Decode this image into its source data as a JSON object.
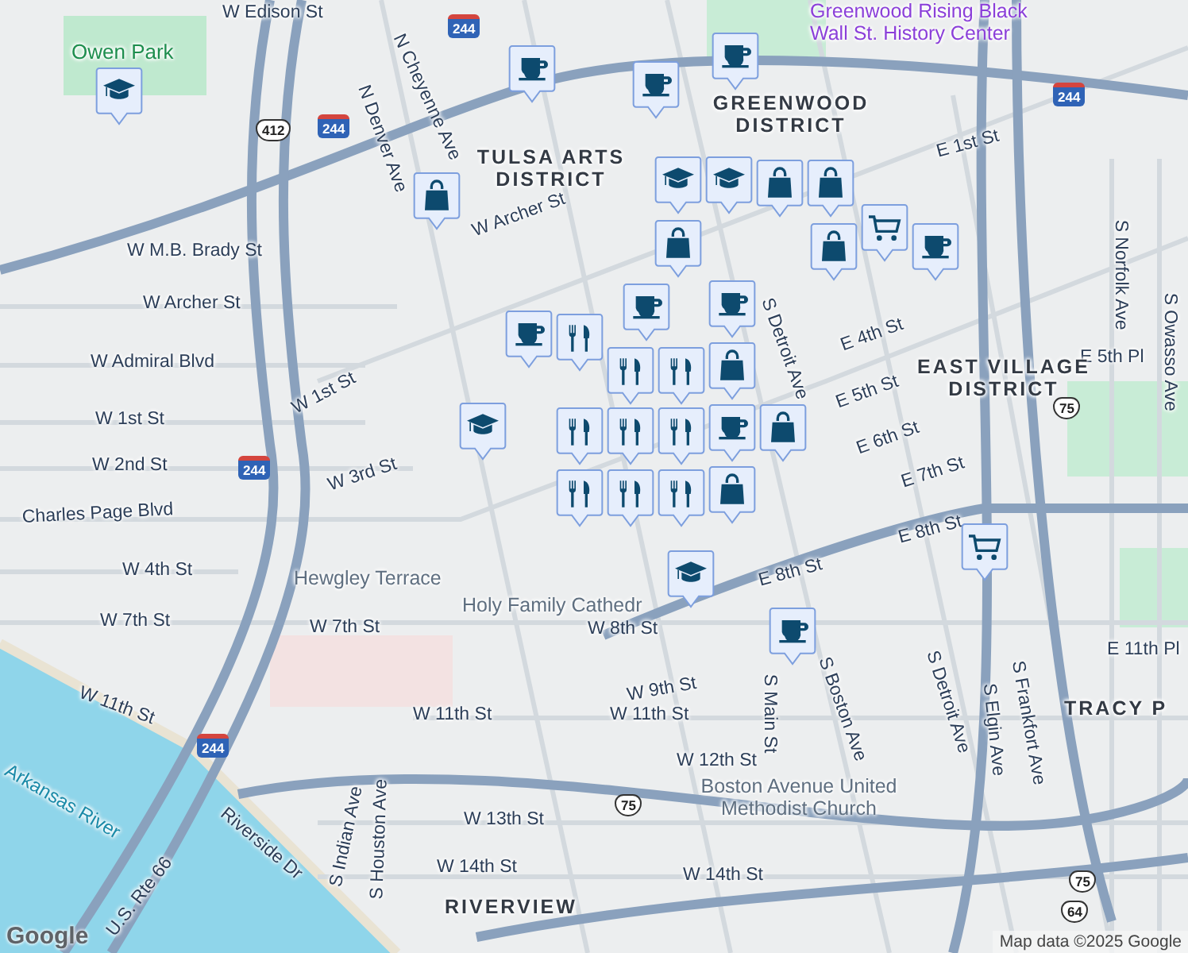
{
  "map": {
    "labels": [
      {
        "kind": "street",
        "text": "W Edison St"
      },
      {
        "kind": "street",
        "text": "N Cheyenne Ave"
      },
      {
        "kind": "street",
        "text": "N Denver Ave"
      },
      {
        "kind": "street",
        "text": "W Archer St"
      },
      {
        "kind": "street",
        "text": "W M.B. Brady St"
      },
      {
        "kind": "street",
        "text": "W Archer St"
      },
      {
        "kind": "street",
        "text": "W Admiral Blvd"
      },
      {
        "kind": "street",
        "text": "W 1st St"
      },
      {
        "kind": "street",
        "text": "W 2nd St"
      },
      {
        "kind": "street",
        "text": "W 1st St"
      },
      {
        "kind": "street",
        "text": "Charles Page Blvd"
      },
      {
        "kind": "street",
        "text": "W 3rd St"
      },
      {
        "kind": "street",
        "text": "W 4th St"
      },
      {
        "kind": "street",
        "text": "W 7th St"
      },
      {
        "kind": "street",
        "text": "W 7th St"
      },
      {
        "kind": "street",
        "text": "W 11th St"
      },
      {
        "kind": "street",
        "text": "W 11th St"
      },
      {
        "kind": "street",
        "text": "Riverside Dr"
      },
      {
        "kind": "street",
        "text": "S Indian Ave"
      },
      {
        "kind": "street",
        "text": "S Houston Ave"
      },
      {
        "kind": "street",
        "text": "W 13th St"
      },
      {
        "kind": "street",
        "text": "W 14th St"
      },
      {
        "kind": "street",
        "text": "U.S. Rte 66"
      },
      {
        "kind": "street",
        "text": "E 1st St"
      },
      {
        "kind": "street",
        "text": "E 4th St"
      },
      {
        "kind": "street",
        "text": "E 5th St"
      },
      {
        "kind": "street",
        "text": "E 6th St"
      },
      {
        "kind": "street",
        "text": "E 7th St"
      },
      {
        "kind": "street",
        "text": "E 8th St"
      },
      {
        "kind": "street",
        "text": "E 8th St"
      },
      {
        "kind": "street",
        "text": "W 8th St"
      },
      {
        "kind": "street",
        "text": "W 9th St"
      },
      {
        "kind": "street",
        "text": "W 11th St"
      },
      {
        "kind": "street",
        "text": "W 12th St"
      },
      {
        "kind": "street",
        "text": "W 14th St"
      },
      {
        "kind": "street",
        "text": "S Main St"
      },
      {
        "kind": "street",
        "text": "S Boston Ave"
      },
      {
        "kind": "street",
        "text": "S Detroit Ave"
      },
      {
        "kind": "street",
        "text": "S Elgin Ave"
      },
      {
        "kind": "street",
        "text": "S Frankfort Ave"
      },
      {
        "kind": "street",
        "text": "S Norfolk Ave"
      },
      {
        "kind": "street",
        "text": "S Owasso Ave"
      },
      {
        "kind": "street",
        "text": "E 5th Pl"
      },
      {
        "kind": "street",
        "text": "E 11th Pl"
      },
      {
        "kind": "street",
        "text": "S Detroit Ave"
      },
      {
        "kind": "district",
        "text": "TULSA ARTS DISTRICT"
      },
      {
        "kind": "district",
        "text": "GREENWOOD DISTRICT"
      },
      {
        "kind": "district",
        "text": "EAST VILLAGE DISTRICT"
      },
      {
        "kind": "district",
        "text": "TRACY P"
      },
      {
        "kind": "district",
        "text": "RIVERVIEW"
      },
      {
        "kind": "park",
        "text": "Owen Park"
      },
      {
        "kind": "museum",
        "text": "Greenwood Rising Black Wall St. History Center"
      },
      {
        "kind": "place",
        "text": "Hewgley Terrace"
      },
      {
        "kind": "place",
        "text": "Holy Family Cathedr"
      },
      {
        "kind": "place",
        "text": "Boston Avenue United Methodist Church"
      },
      {
        "kind": "water",
        "text": "Arkansas River"
      },
      {
        "kind": "interstate",
        "text": "244"
      },
      {
        "kind": "interstate",
        "text": "244"
      },
      {
        "kind": "interstate",
        "text": "244"
      },
      {
        "kind": "interstate",
        "text": "244"
      },
      {
        "kind": "interstate",
        "text": "244"
      },
      {
        "kind": "us",
        "text": "412"
      },
      {
        "kind": "us",
        "text": "75"
      },
      {
        "kind": "us",
        "text": "75"
      },
      {
        "kind": "us",
        "text": "75"
      },
      {
        "kind": "us",
        "text": "64"
      }
    ],
    "pins": [
      {
        "kind": "school"
      },
      {
        "kind": "coffee"
      },
      {
        "kind": "coffee"
      },
      {
        "kind": "coffee"
      },
      {
        "kind": "school"
      },
      {
        "kind": "school"
      },
      {
        "kind": "shopping"
      },
      {
        "kind": "shopping"
      },
      {
        "kind": "shopping"
      },
      {
        "kind": "shopping"
      },
      {
        "kind": "grocery"
      },
      {
        "kind": "coffee"
      },
      {
        "kind": "shopping"
      },
      {
        "kind": "coffee"
      },
      {
        "kind": "coffee"
      },
      {
        "kind": "coffee"
      },
      {
        "kind": "restaurant"
      },
      {
        "kind": "restaurant"
      },
      {
        "kind": "restaurant"
      },
      {
        "kind": "shopping"
      },
      {
        "kind": "restaurant"
      },
      {
        "kind": "restaurant"
      },
      {
        "kind": "restaurant"
      },
      {
        "kind": "school"
      },
      {
        "kind": "restaurant"
      },
      {
        "kind": "restaurant"
      },
      {
        "kind": "restaurant"
      },
      {
        "kind": "coffee"
      },
      {
        "kind": "shopping"
      },
      {
        "kind": "shopping"
      },
      {
        "kind": "school"
      },
      {
        "kind": "coffee"
      },
      {
        "kind": "grocery"
      }
    ],
    "logo": "Google",
    "attribution": "Map data ©2025 Google"
  }
}
